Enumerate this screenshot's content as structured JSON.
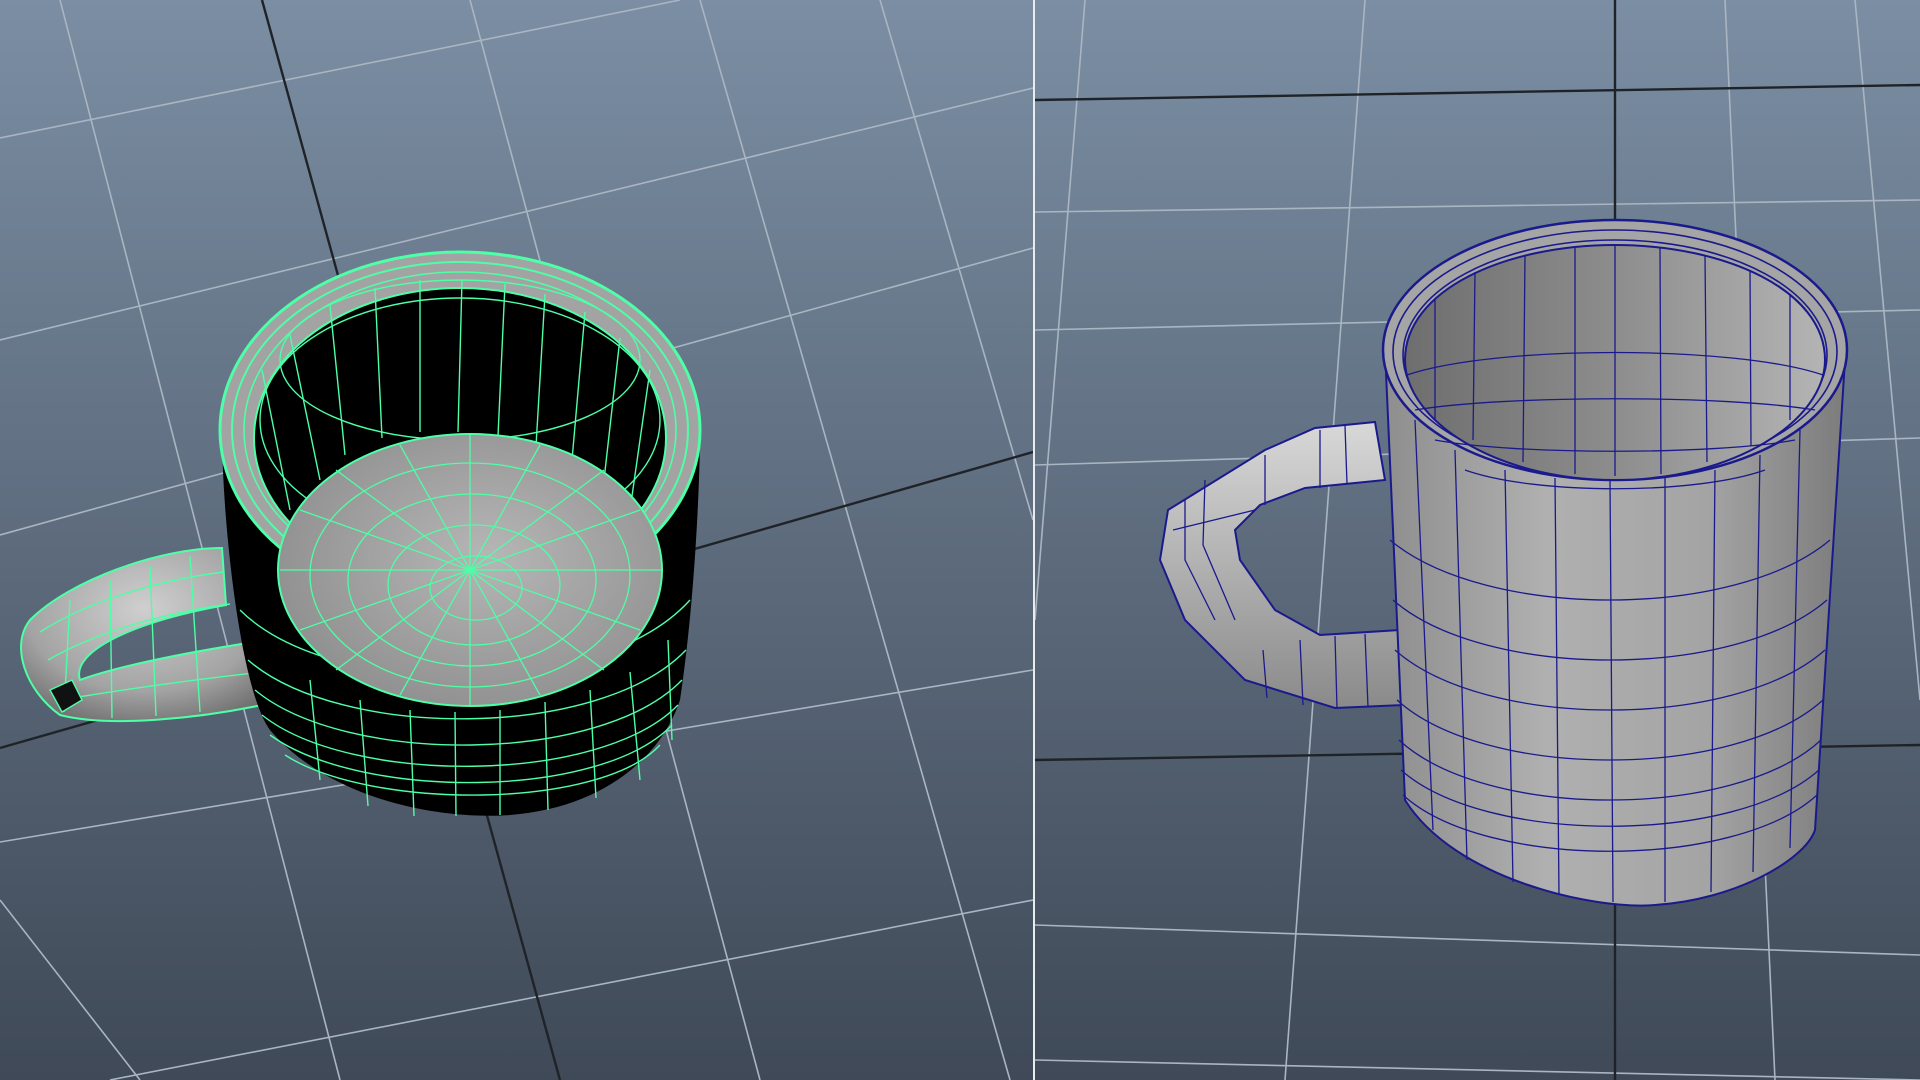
{
  "viewports": [
    {
      "name": "perspective-viewport-left",
      "object": "mug-mesh",
      "state": "selected",
      "shading": "smooth-shade-with-wireframe",
      "wire_color": "#4dffa6"
    },
    {
      "name": "perspective-viewport-right",
      "object": "mug-mesh",
      "state": "unselected",
      "shading": "smooth-shade-with-wireframe",
      "wire_color": "#1a1a8c"
    }
  ],
  "colors": {
    "bg_top": "#7b8ea3",
    "bg_bottom": "#3f4957",
    "grid_line": "#a9b5c2",
    "grid_axis": "#1f2328",
    "mesh_fill": "#a3a3a3",
    "mesh_dark": "#000000"
  }
}
